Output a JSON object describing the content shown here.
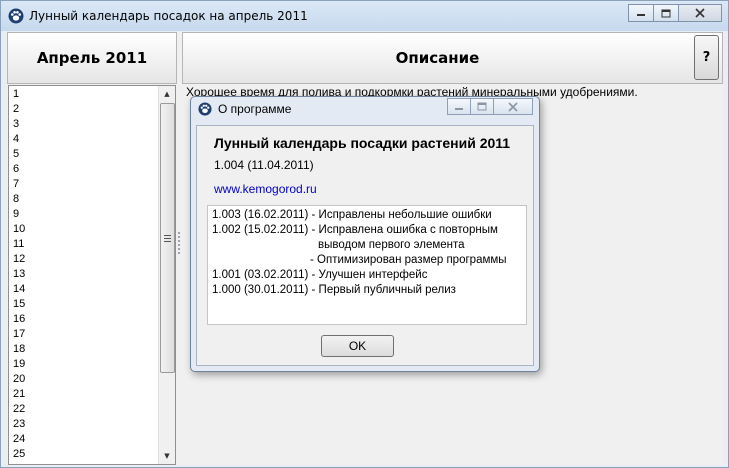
{
  "window": {
    "title": "Лунный календарь посадок на апрель 2011"
  },
  "left_panel": {
    "header": "Апрель 2011",
    "days": [
      "1",
      "2",
      "3",
      "4",
      "5",
      "6",
      "7",
      "8",
      "9",
      "10",
      "11",
      "12",
      "13",
      "14",
      "15",
      "16",
      "17",
      "18",
      "19",
      "20",
      "21",
      "22",
      "23",
      "24",
      "25"
    ]
  },
  "right_panel": {
    "header": "Описание",
    "help_label": "?",
    "description": "Хорошее время для полива и подкормки растений минеральными удобрениями."
  },
  "about_dialog": {
    "title": "О программе",
    "program_name": "Лунный календарь посадки растений 2011",
    "version": "1.004 (11.04.2011)",
    "link": "www.kemogorod.ru",
    "history": [
      "1.003 (16.02.2011) - Исправлены небольшие ошибки",
      "1.002 (15.02.2011) - Исправлена ошибка с повторным",
      "выводом первого элемента",
      "- Оптимизирован размер программы",
      "1.001 (03.02.2011) - Улучшен интерфейс",
      "1.000 (30.01.2011) - Первый публичный релиз"
    ],
    "ok_label": "OK"
  }
}
